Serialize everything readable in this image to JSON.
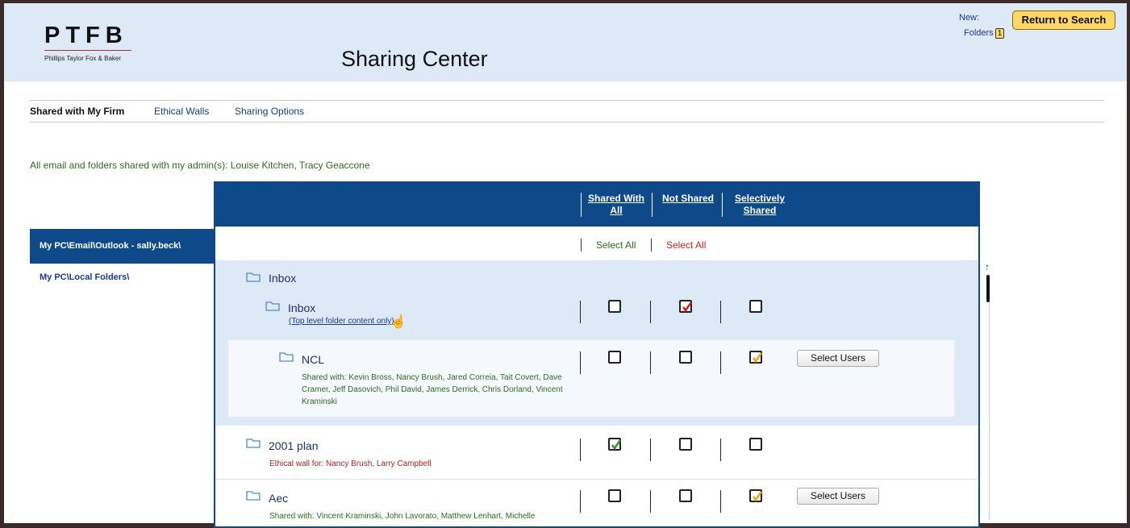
{
  "header": {
    "logo_text": "PTFB",
    "logo_subtitle": "Phillips Taylor Fox & Baker",
    "title": "Sharing Center",
    "new_label": "New:",
    "folders_link": "Folders",
    "folders_count": "1",
    "return_button": "Return to Search"
  },
  "nav": {
    "tabs": [
      "Shared with My Firm",
      "Ethical Walls",
      "Sharing Options"
    ]
  },
  "admin_line": "All email and folders shared with my admin(s):  Louise Kitchen, Tracy Geaccone",
  "sidebar": {
    "items": [
      "My PC\\Email\\Outlook - sally.beck\\",
      "My PC\\Local Folders\\"
    ]
  },
  "columns": {
    "shared_all": "Shared With All",
    "not_shared": "Not Shared",
    "selective": "Selectively Shared"
  },
  "select_all": {
    "green": "Select All",
    "red": "Select All"
  },
  "folders": [
    {
      "name": "Inbox"
    },
    {
      "name": "Inbox",
      "note": "(Top level folder content only)",
      "shared_all": false,
      "not_shared": true,
      "selective": false
    },
    {
      "name": "NCL",
      "note": "Shared with: Kevin Bross, Nancy Brush, Jared Correia, Tait Covert, Dave Cramer, Jeff Dasovich, Phil David, James Derrick, Chris Dorland, Vincent Kraminski",
      "shared_all": false,
      "not_shared": false,
      "selective": true,
      "button": "Select Users"
    },
    {
      "name": "2001 plan",
      "note": "Ethical wall for: Nancy Brush, Larry Campbell",
      "shared_all": true,
      "not_shared": false,
      "selective": false
    },
    {
      "name": "Aec",
      "note": "Shared with: Vincent Kraminski, John Lavorato, Matthew Lenhart, Michelle",
      "shared_all": false,
      "not_shared": false,
      "selective": true,
      "button": "Select Users"
    }
  ],
  "colors": {
    "header_bg": "#dde9f7",
    "panel_blue": "#0e4a8a",
    "badge_yellow": "#ffd766",
    "check_red": "#d42020",
    "check_green": "#2f9a2a",
    "check_orange": "#f0a020"
  }
}
